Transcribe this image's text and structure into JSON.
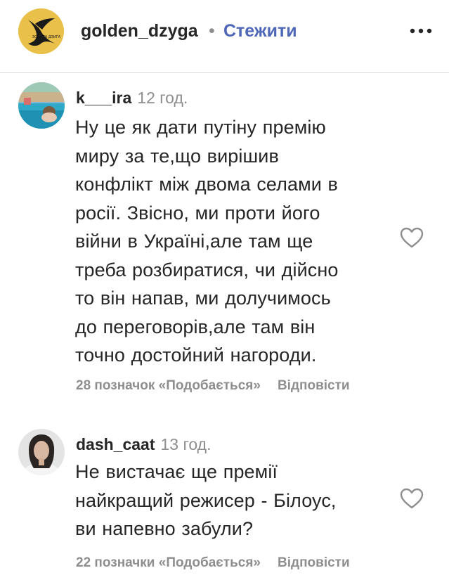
{
  "header": {
    "username": "golden_dzyga",
    "separator": "•",
    "follow_label": "Стежити",
    "logo_text": "ЗОЛОТА ДЗИҐА"
  },
  "comments": [
    {
      "username": "k___ira",
      "time": "12 год.",
      "lines": [
        "Ну це як дати путіну премію",
        "миру за те,що вирішив",
        "конфлікт між двома селами в",
        "росії. Звісно, ми проти його",
        "війни в Україні,але там ще",
        "треба розбиратися, чи дійсно",
        "то він напав, ми долучимось",
        "до переговорів,але там він",
        "точно достойний нагороди."
      ],
      "likes": "28 позначок «Подобається»",
      "reply": "Відповісти"
    },
    {
      "username": "dash_caat",
      "time": "13 год.",
      "lines": [
        "Не вистачає ще премії",
        "найкращий режисер - Білоус,",
        "ви напевно забули?"
      ],
      "likes": "22 позначки «Подобається»",
      "reply": "Відповісти"
    }
  ],
  "colors": {
    "accent": "#4f67b7",
    "logo_bg": "#e9c14a",
    "muted": "#8e8e8e",
    "text": "#262626"
  },
  "icons": {
    "more": "more-horizontal-icon",
    "like": "heart-outline-icon"
  }
}
